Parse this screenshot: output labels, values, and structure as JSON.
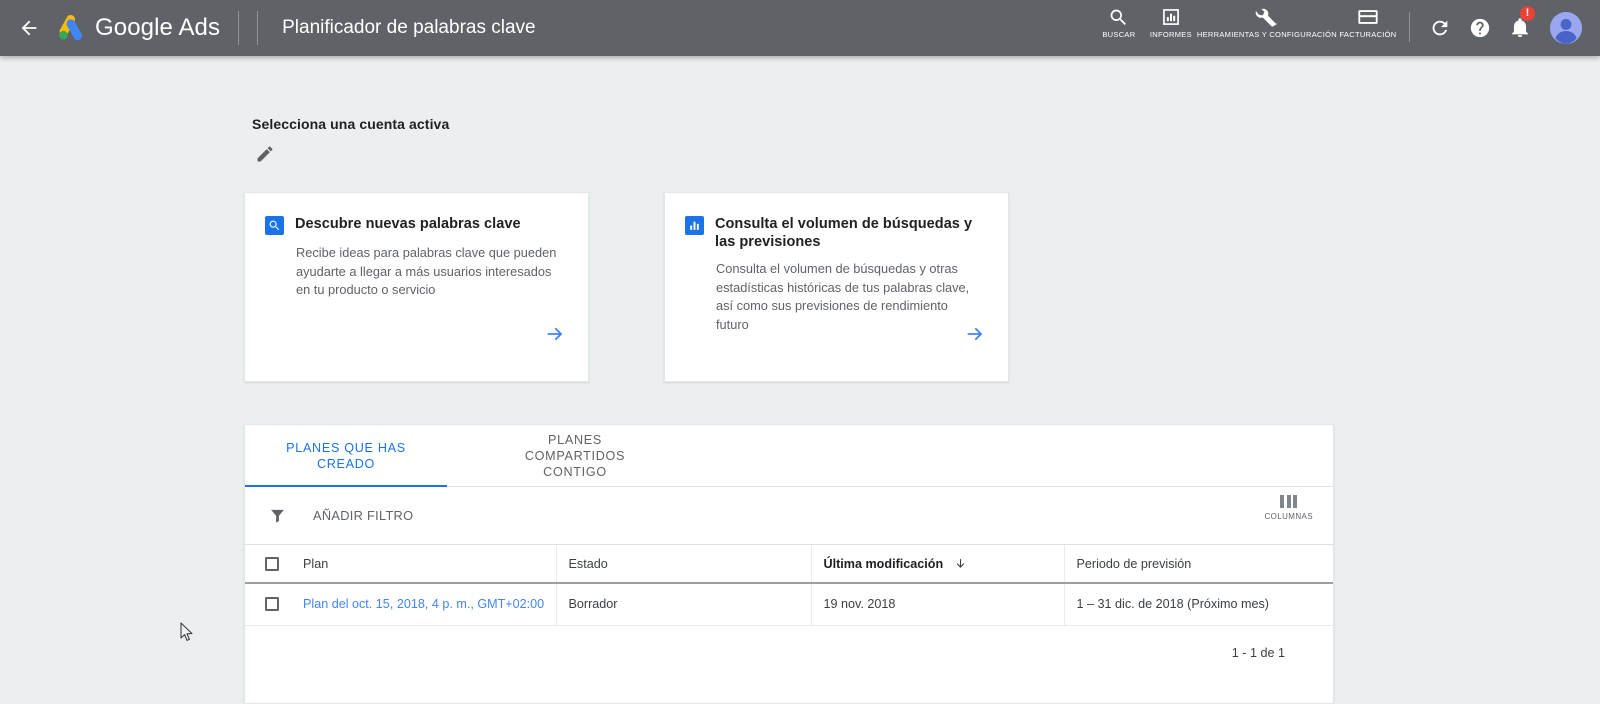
{
  "topbar": {
    "back_icon": "arrow-left-icon",
    "brand": {
      "google": "Google",
      "ads": " Ads"
    },
    "page_title": "Planificador de palabras clave",
    "items": [
      {
        "icon": "search-icon",
        "label": "BUSCAR"
      },
      {
        "icon": "reports-bar-chart-icon",
        "label": "INFORMES"
      },
      {
        "icon": "wrench-tools-icon",
        "label": "HERRAMIENTAS Y CONFIGURACIÓN"
      },
      {
        "icon": "credit-card-icon",
        "label": "FACTURACIÓN"
      }
    ],
    "refresh_icon": "refresh-icon",
    "help_icon": "help-question-icon",
    "notifications_icon": "bell-icon",
    "notifications_badge": "!",
    "avatar": "user-avatar"
  },
  "account": {
    "label": "Selecciona una cuenta activa",
    "edit_icon": "pencil-edit-icon"
  },
  "cards": [
    {
      "icon": "search-square-icon",
      "title": "Descubre nuevas palabras clave",
      "body": "Recibe ideas para palabras clave que pueden ayudarte a llegar a más usuarios interesados en tu producto o servicio",
      "arrow": "arrow-right-icon"
    },
    {
      "icon": "bar-chart-square-icon",
      "title": "Consulta el volumen de búsquedas y las previsiones",
      "body": "Consulta el volumen de búsquedas y otras estadísticas históricas de tus palabras clave, así como sus previsiones de rendimiento futuro",
      "arrow": "arrow-right-icon"
    }
  ],
  "plans_panel": {
    "tabs": [
      {
        "label": "PLANES QUE HAS CREADO",
        "active": true
      },
      {
        "label": "PLANES COMPARTIDOS CONTIGO",
        "active": false
      }
    ],
    "filter": {
      "icon": "funnel-filter-icon",
      "label": "AÑADIR FILTRO"
    },
    "columns_button": {
      "icon": "columns-icon",
      "label": "COLUMNAS"
    },
    "table": {
      "headers": [
        "Plan",
        "Estado",
        "Última modificación",
        "Periodo de previsión"
      ],
      "sorted_column": "Última modificación",
      "sort_direction": "descending",
      "rows": [
        {
          "plan": "Plan del oct. 15, 2018, 4 p. m., GMT+02:00",
          "estado": "Borrador",
          "ultima_modificacion": "19 nov. 2018",
          "periodo_prevision": "1 – 31 dic. de 2018 (Próximo mes)"
        }
      ]
    },
    "pagination": "1 - 1 de 1"
  },
  "colors": {
    "topbar_bg": "#5f6368",
    "page_bg": "#eceff0",
    "accent_blue": "#1a73e8",
    "link_blue": "#4285f4",
    "badge_red": "#ea4335"
  }
}
